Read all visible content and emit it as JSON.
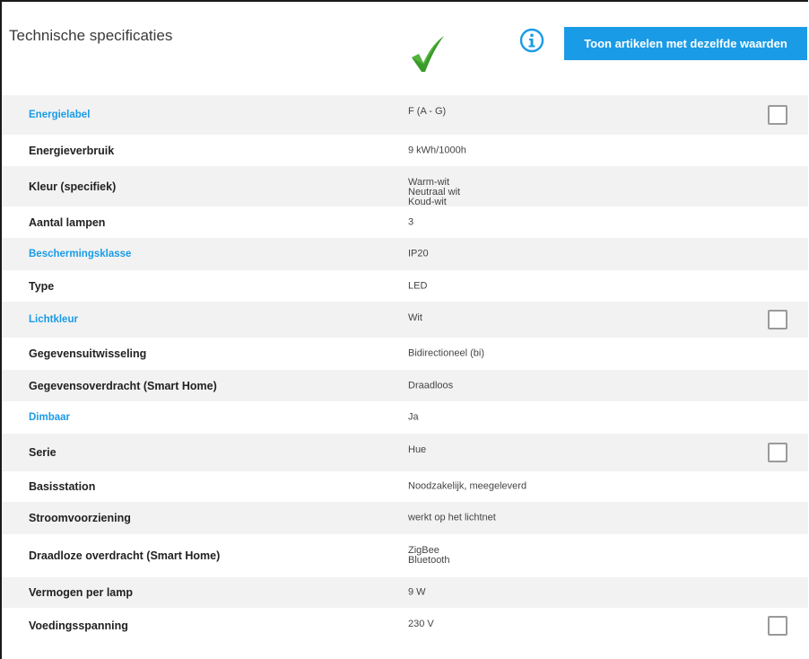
{
  "header": {
    "title": "Technische specificaties",
    "button_label": "Toon artikelen met dezelfde waarden",
    "colors": {
      "accent": "#1a9be6",
      "check": "#3a9a2a"
    }
  },
  "rows": [
    {
      "label": "Energielabel",
      "link": true,
      "values": [
        "F (A - G)"
      ],
      "checkbox": true,
      "shade": true
    },
    {
      "label": "Energieverbruik",
      "link": false,
      "values": [
        "9 kWh/1000h"
      ],
      "checkbox": false,
      "shade": false
    },
    {
      "label": "Kleur (specifiek)",
      "link": false,
      "values": [
        "Warm-wit",
        "Neutraal wit",
        "Koud-wit"
      ],
      "checkbox": false,
      "shade": true
    },
    {
      "label": "Aantal lampen",
      "link": false,
      "values": [
        "3"
      ],
      "checkbox": false,
      "shade": false
    },
    {
      "label": "Beschermingsklasse",
      "link": true,
      "values": [
        "IP20"
      ],
      "checkbox": false,
      "shade": true
    },
    {
      "label": "Type",
      "link": false,
      "values": [
        "LED"
      ],
      "checkbox": false,
      "shade": false
    },
    {
      "label": "Lichtkleur",
      "link": true,
      "values": [
        "Wit"
      ],
      "checkbox": true,
      "shade": true
    },
    {
      "label": "Gegevensuitwisseling",
      "link": false,
      "values": [
        "Bidirectioneel (bi)"
      ],
      "checkbox": false,
      "shade": false
    },
    {
      "label": "Gegevensoverdracht (Smart Home)",
      "link": false,
      "values": [
        "Draadloos"
      ],
      "checkbox": false,
      "shade": true
    },
    {
      "label": "Dimbaar",
      "link": true,
      "values": [
        "Ja"
      ],
      "checkbox": false,
      "shade": false
    },
    {
      "label": "Serie",
      "link": false,
      "values": [
        "Hue"
      ],
      "checkbox": true,
      "shade": true
    },
    {
      "label": "Basisstation",
      "link": false,
      "values": [
        "Noodzakelijk, meegeleverd"
      ],
      "checkbox": false,
      "shade": false
    },
    {
      "label": "Stroomvoorziening",
      "link": false,
      "values": [
        "werkt op het lichtnet"
      ],
      "checkbox": false,
      "shade": true
    },
    {
      "label": "Draadloze overdracht (Smart Home)",
      "link": false,
      "values": [
        "ZigBee",
        "Bluetooth"
      ],
      "checkbox": false,
      "shade": false
    },
    {
      "label": "Vermogen per lamp",
      "link": false,
      "values": [
        "9 W"
      ],
      "checkbox": false,
      "shade": true
    },
    {
      "label": "Voedingsspanning",
      "link": false,
      "values": [
        "230 V"
      ],
      "checkbox": true,
      "shade": false
    }
  ]
}
